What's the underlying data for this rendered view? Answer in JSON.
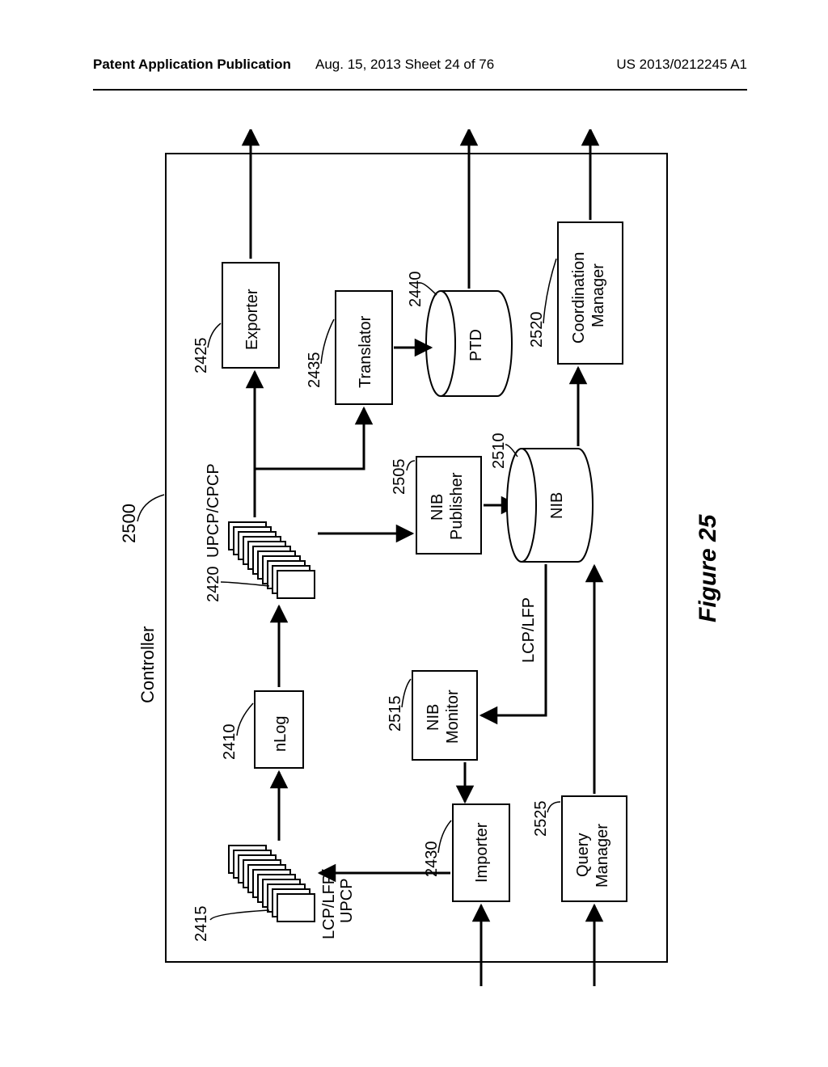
{
  "header": {
    "left": "Patent Application Publication",
    "center": "Aug. 15, 2013   Sheet 24 of 76",
    "right": "US 2013/0212245 A1"
  },
  "figure_caption": "Figure 25",
  "diagram": {
    "controller_label": "Controller",
    "controller_ref": "2500",
    "nodes": {
      "input_stack": {
        "label": "LCP/LFP/\nUPCP",
        "ref": "2415"
      },
      "nlog": {
        "label": "nLog",
        "ref": "2410"
      },
      "output_stack": {
        "label": "UPCP/CPCP",
        "ref": "2420"
      },
      "exporter": {
        "label": "Exporter",
        "ref": "2425"
      },
      "importer": {
        "label": "Importer",
        "ref": "2430"
      },
      "nib_monitor": {
        "label": "NIB\nMonitor",
        "ref": "2515"
      },
      "translator": {
        "label": "Translator",
        "ref": "2435"
      },
      "nib_publisher": {
        "label": "NIB\nPublisher",
        "ref": "2505"
      },
      "nib": {
        "label": "NIB",
        "ref": "2510"
      },
      "ptd": {
        "label": "PTD",
        "ref": "2440"
      },
      "query_manager": {
        "label": "Query\nManager",
        "ref": "2525"
      },
      "coord_manager": {
        "label": "Coordination\nManager",
        "ref": "2520"
      },
      "nib_lcp_lfp": {
        "label": "LCP/LFP"
      }
    }
  }
}
